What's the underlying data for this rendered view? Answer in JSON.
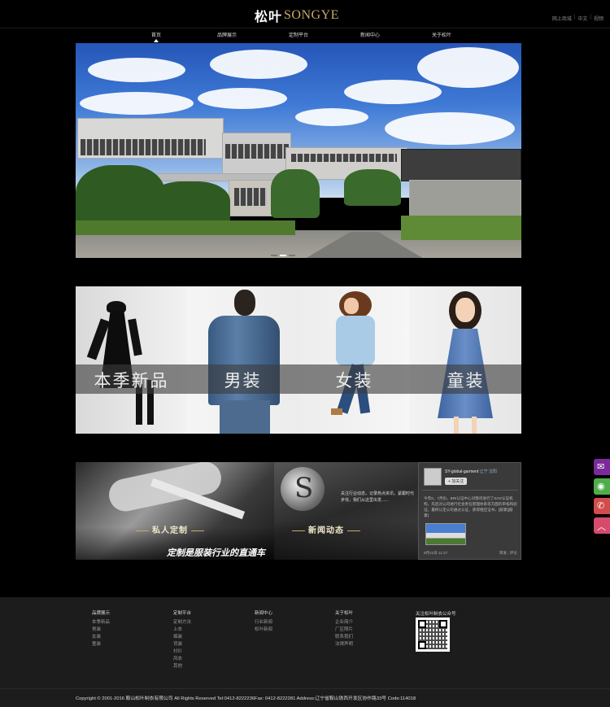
{
  "header": {
    "logo_cn": "松叶",
    "logo_en": "SONGYE",
    "top_links": [
      "网上商城",
      "中文",
      "视频"
    ]
  },
  "nav": {
    "items": [
      {
        "label": "首页",
        "active": true
      },
      {
        "label": "品牌展示",
        "active": false
      },
      {
        "label": "定制平台",
        "active": false
      },
      {
        "label": "新闻中心",
        "active": false
      },
      {
        "label": "关于松叶",
        "active": false
      }
    ]
  },
  "banner": {
    "slides_total": 3,
    "active_slide": 2
  },
  "categories": [
    {
      "label": "本季新品"
    },
    {
      "label": "男装"
    },
    {
      "label": "女装"
    },
    {
      "label": "童装"
    }
  ],
  "features": {
    "custom": {
      "title": "私人定制",
      "subtitle": "定制是服装行业的直通车"
    },
    "news": {
      "title": "新闻动态",
      "text": "关注行业动态，记录热点资讯，紧跟时代步伐，我们从这里出发......"
    },
    "weibo": {
      "name": "SY-global-garment",
      "location": "辽宁 沈阳",
      "follow_label": "+ 加关注",
      "post": "今年6，7月份，BRI认证中心对我司进行了SGS认证机构，先后对公司进行社会责任管理体系等方面的审核和验证，最终认定公司通过认证，获得相应证书，[鼓掌][鼓掌]",
      "time": "8月22日 11:37",
      "actions": [
        "转发",
        "评论"
      ]
    }
  },
  "side_buttons": [
    {
      "icon": "wechat-icon",
      "glyph": "✉",
      "color": "#7a2a9a"
    },
    {
      "icon": "qq-icon",
      "glyph": "◉",
      "color": "#4fae4a"
    },
    {
      "icon": "phone-icon",
      "glyph": "✆",
      "color": "#d44b4b"
    },
    {
      "icon": "back-to-top-icon",
      "glyph": "︿",
      "color": "#d44b6b"
    }
  ],
  "footer": {
    "columns": [
      {
        "title": "品牌展示",
        "items": [
          "本季新品",
          "男装",
          "女装",
          "童装"
        ]
      },
      {
        "title": "定制平台",
        "items": [
          "定制方法",
          "上衣",
          "裤装",
          "背装",
          "衬衫",
          "风衣",
          "其他"
        ]
      },
      {
        "title": "新闻中心",
        "items": [
          "行业新闻",
          "松叶新闻"
        ]
      },
      {
        "title": "关于松叶",
        "items": [
          "企业简介",
          "厂区照片",
          "联系我们",
          "法律声明"
        ]
      }
    ],
    "qr_title": "关注松叶制衣公众号",
    "copyright": "Copyright © 2001-2016 鞍山松叶制衣有限公司 All Rights Reserved Tel:0412-8222236Fax: 0412-8222281 Address:辽宁省鞍山铁西开发区协作路33号 Code:114018"
  }
}
